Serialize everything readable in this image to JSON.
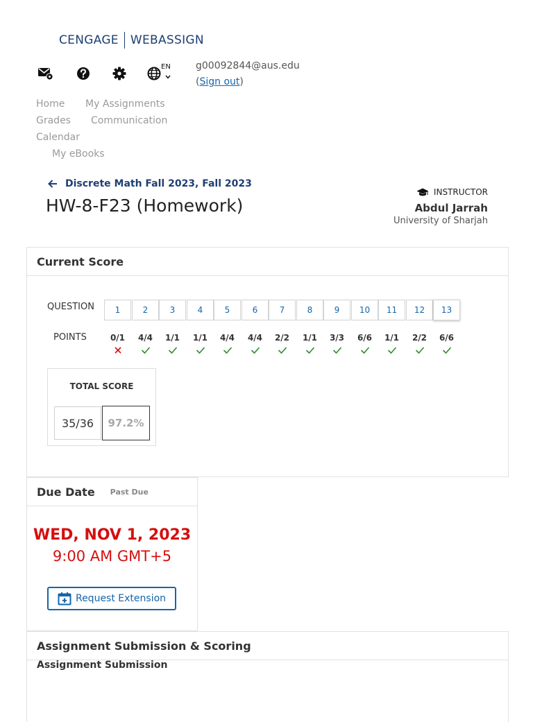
{
  "brand": {
    "name": "CENGAGE",
    "product": "WEBASSIGN"
  },
  "utility": {
    "icons": [
      "mail-settings-icon",
      "help-icon",
      "gear-icon",
      "globe-icon"
    ],
    "language": "EN"
  },
  "user": {
    "email": "g00092844@aus.edu",
    "open_paren": "(",
    "signout": "Sign out",
    "close_paren": ")"
  },
  "nav": {
    "home": "Home",
    "my_assignments": "My Assignments",
    "grades": "Grades",
    "communication": "Communication",
    "calendar": "Calendar",
    "my_ebooks": "My eBooks"
  },
  "course": {
    "back_label": "Discrete Math Fall 2023, Fall 2023"
  },
  "assignment": {
    "title": "HW-8-F23 (Homework)"
  },
  "instructor": {
    "label": "INSTRUCTOR",
    "name": "Abdul Jarrah",
    "org": "University of Sharjah"
  },
  "score": {
    "heading": "Current Score",
    "question_label": "QUESTION",
    "points_label": "POINTS",
    "questions": [
      "1",
      "2",
      "3",
      "4",
      "5",
      "6",
      "7",
      "8",
      "9",
      "10",
      "11",
      "12",
      "13"
    ],
    "points": [
      "0/1",
      "4/4",
      "1/1",
      "1/1",
      "4/4",
      "4/4",
      "2/2",
      "1/1",
      "3/3",
      "6/6",
      "1/1",
      "2/2",
      "6/6"
    ],
    "correct": [
      false,
      true,
      true,
      true,
      true,
      true,
      true,
      true,
      true,
      true,
      true,
      true,
      true
    ],
    "total_label": "TOTAL SCORE",
    "total": "35/36",
    "percent": "97.2%",
    "colors": {
      "correct": "#2e8b2e",
      "incorrect": "#d50f0f"
    }
  },
  "due": {
    "heading": "Due Date",
    "status": "Past Due",
    "date": "WED, NOV 1, 2023",
    "time": "9:00 AM GMT+5",
    "extension_button": "Request Extension",
    "color": "#d50f0f"
  },
  "submission": {
    "heading": "Assignment Submission & Scoring",
    "subheading": "Assignment Submission"
  }
}
